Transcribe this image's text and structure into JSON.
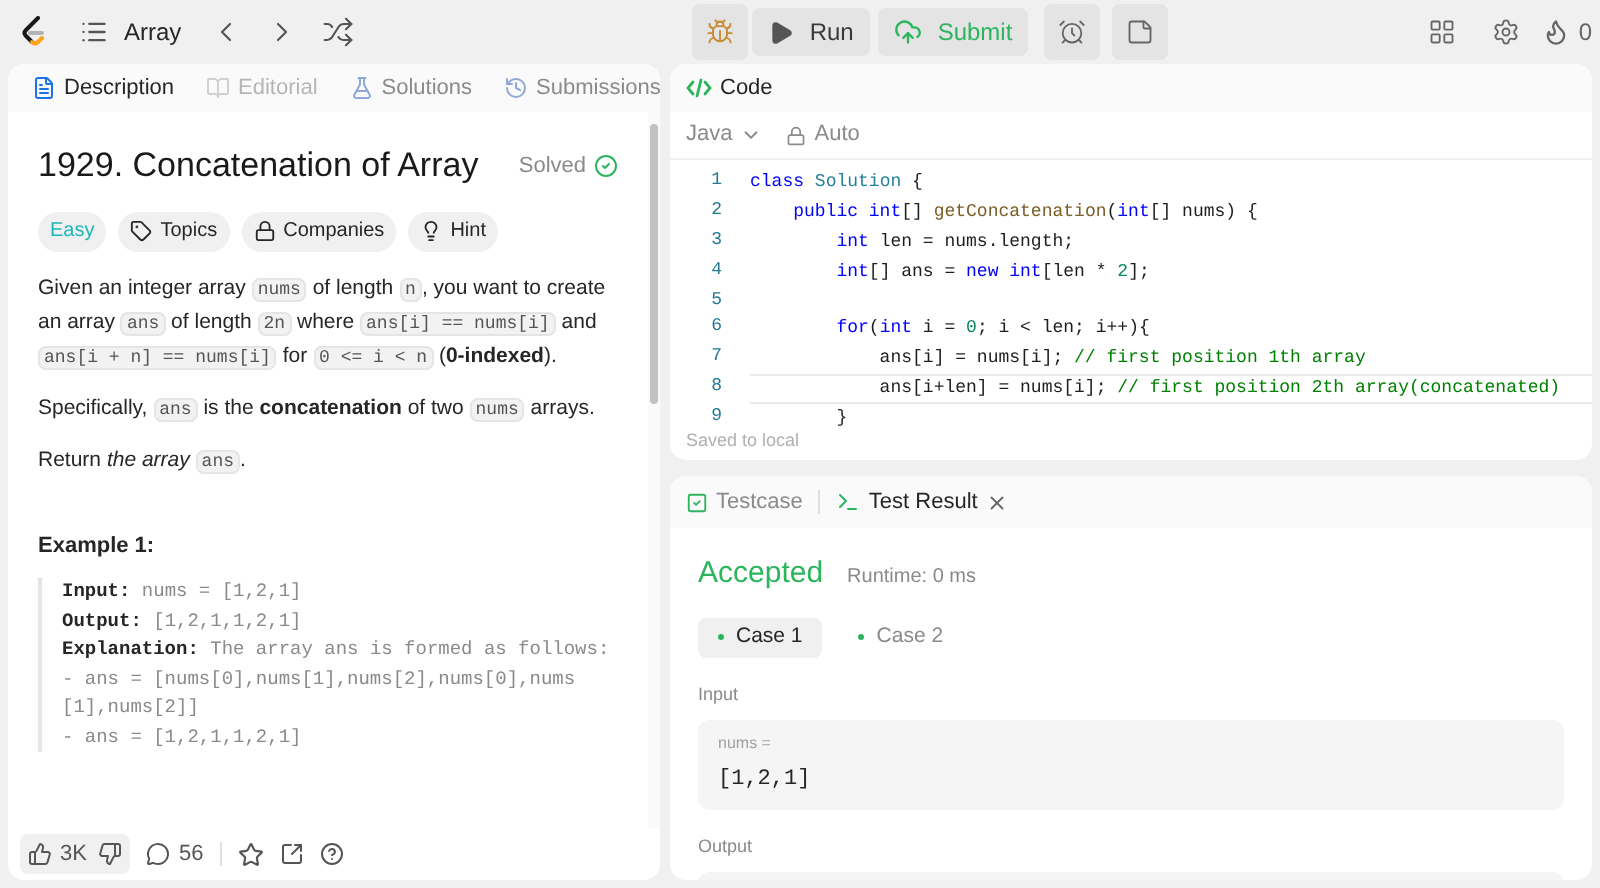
{
  "top_bar": {
    "problem_list": "Array",
    "run": "Run",
    "submit": "Submit",
    "streak": "0"
  },
  "description_panel": {
    "tabs": [
      {
        "label": "Description",
        "selected": true,
        "disabled": false
      },
      {
        "label": "Editorial",
        "selected": false,
        "disabled": true
      },
      {
        "label": "Solutions",
        "selected": false,
        "disabled": false
      },
      {
        "label": "Submissions",
        "selected": false,
        "disabled": false
      }
    ],
    "title": "1929. Concatenation of Array",
    "status": "Solved",
    "tags": [
      {
        "label": "Easy",
        "kind": "difficulty"
      },
      {
        "label": "Topics",
        "kind": "chip"
      },
      {
        "label": "Companies",
        "kind": "chip"
      },
      {
        "label": "Hint",
        "kind": "chip"
      }
    ],
    "paragraphs": [
      [
        {
          "kind": "text",
          "t": "Given an integer array "
        },
        {
          "kind": "code",
          "t": "nums"
        },
        {
          "kind": "text",
          "t": " of length "
        },
        {
          "kind": "code",
          "t": "n"
        },
        {
          "kind": "text",
          "t": ", you want to create an array "
        },
        {
          "kind": "code",
          "t": "ans"
        },
        {
          "kind": "text",
          "t": " of length "
        },
        {
          "kind": "code",
          "t": "2n"
        },
        {
          "kind": "text",
          "t": " where "
        },
        {
          "kind": "code",
          "t": "ans[i] == nums[i]"
        },
        {
          "kind": "text",
          "t": " and "
        },
        {
          "kind": "code",
          "t": "ans[i + n] == nums[i]"
        },
        {
          "kind": "text",
          "t": " for "
        },
        {
          "kind": "code",
          "t": "0 <= i < n"
        },
        {
          "kind": "text",
          "t": " ("
        },
        {
          "kind": "bold",
          "t": "0-indexed"
        },
        {
          "kind": "text",
          "t": ")."
        }
      ],
      [
        {
          "kind": "text",
          "t": "Specifically, "
        },
        {
          "kind": "code",
          "t": "ans"
        },
        {
          "kind": "text",
          "t": " is the "
        },
        {
          "kind": "bold",
          "t": "concatenation"
        },
        {
          "kind": "text",
          "t": " of two "
        },
        {
          "kind": "code",
          "t": "nums"
        },
        {
          "kind": "text",
          "t": " arrays."
        }
      ],
      [
        {
          "kind": "text",
          "t": "Return "
        },
        {
          "kind": "italic",
          "t": "the array "
        },
        {
          "kind": "code",
          "t": "ans"
        },
        {
          "kind": "text",
          "t": "."
        }
      ]
    ],
    "example": {
      "heading": "Example 1:",
      "lines": [
        {
          "label": "Input:",
          "value": "nums = [1,2,1]"
        },
        {
          "label": "Output:",
          "value": "[1,2,1,1,2,1]"
        },
        {
          "label": "Explanation:",
          "value": "The array ans is formed as follows:"
        },
        {
          "value": "- ans = [nums[0],nums[1],nums[2],nums[0],nums[1],nums[2]]"
        },
        {
          "value": "- ans = [1,2,1,1,2,1]"
        }
      ]
    },
    "likes": "3K",
    "comments": "56"
  },
  "code_panel": {
    "title": "Code",
    "language": "Java",
    "mode": "Auto",
    "status": "Saved to local",
    "lines": [
      {
        "number": "1",
        "current": false,
        "segments": [
          {
            "kind": "kw",
            "t": "class"
          },
          {
            "kind": "type",
            "t": " Solution"
          },
          {
            "kind": "plain",
            "t": " {"
          }
        ]
      },
      {
        "number": "2",
        "current": false,
        "segments": [
          {
            "kind": "kw",
            "t": "    public int"
          },
          {
            "kind": "plain",
            "t": "[] "
          },
          {
            "kind": "fn",
            "t": "getConcatenation"
          },
          {
            "kind": "plain",
            "t": "("
          },
          {
            "kind": "kw",
            "t": "int"
          },
          {
            "kind": "plain",
            "t": "[] nums) {"
          }
        ]
      },
      {
        "number": "3",
        "current": false,
        "segments": [
          {
            "kind": "kw",
            "t": "        int"
          },
          {
            "kind": "plain",
            "t": " len = nums.length;"
          }
        ]
      },
      {
        "number": "4",
        "current": false,
        "segments": [
          {
            "kind": "kw",
            "t": "        int"
          },
          {
            "kind": "plain",
            "t": "[] ans = "
          },
          {
            "kind": "kw",
            "t": "new int"
          },
          {
            "kind": "plain",
            "t": "[len * "
          },
          {
            "kind": "num",
            "t": "2"
          },
          {
            "kind": "plain",
            "t": "];"
          }
        ]
      },
      {
        "number": "5",
        "current": false
      },
      {
        "number": "6",
        "current": false,
        "segments": [
          {
            "kind": "kw",
            "t": "        for"
          },
          {
            "kind": "plain",
            "t": "("
          },
          {
            "kind": "kw",
            "t": "int"
          },
          {
            "kind": "plain",
            "t": " i = "
          },
          {
            "kind": "num",
            "t": "0"
          },
          {
            "kind": "plain",
            "t": "; i < len; i++){"
          }
        ]
      },
      {
        "number": "7",
        "current": false,
        "segments": [
          {
            "kind": "plain",
            "t": "            ans[i] = nums[i]; "
          },
          {
            "kind": "comment",
            "t": "// first position 1th array"
          }
        ]
      },
      {
        "number": "8",
        "current": true,
        "segments": [
          {
            "kind": "plain",
            "t": "            ans[i+len] = nums[i]; "
          },
          {
            "kind": "comment",
            "t": "// first position 2th array(concatenated)"
          }
        ]
      },
      {
        "number": "9",
        "current": false,
        "segments": [
          {
            "kind": "plain",
            "t": "        }"
          }
        ]
      }
    ]
  },
  "test_panel": {
    "tabs": [
      {
        "label": "Testcase",
        "selected": false,
        "closable": false
      },
      {
        "label": "Test Result",
        "selected": true,
        "closable": true
      }
    ],
    "result": "Accepted",
    "runtime": "Runtime: 0 ms",
    "cases": [
      {
        "label": "Case 1",
        "selected": true,
        "passed": true
      },
      {
        "label": "Case 2",
        "selected": false,
        "passed": true
      }
    ],
    "input_label": "Input",
    "inputs": [
      {
        "name": "nums =",
        "value": "[1,2,1]"
      }
    ],
    "output_label": "Output"
  }
}
